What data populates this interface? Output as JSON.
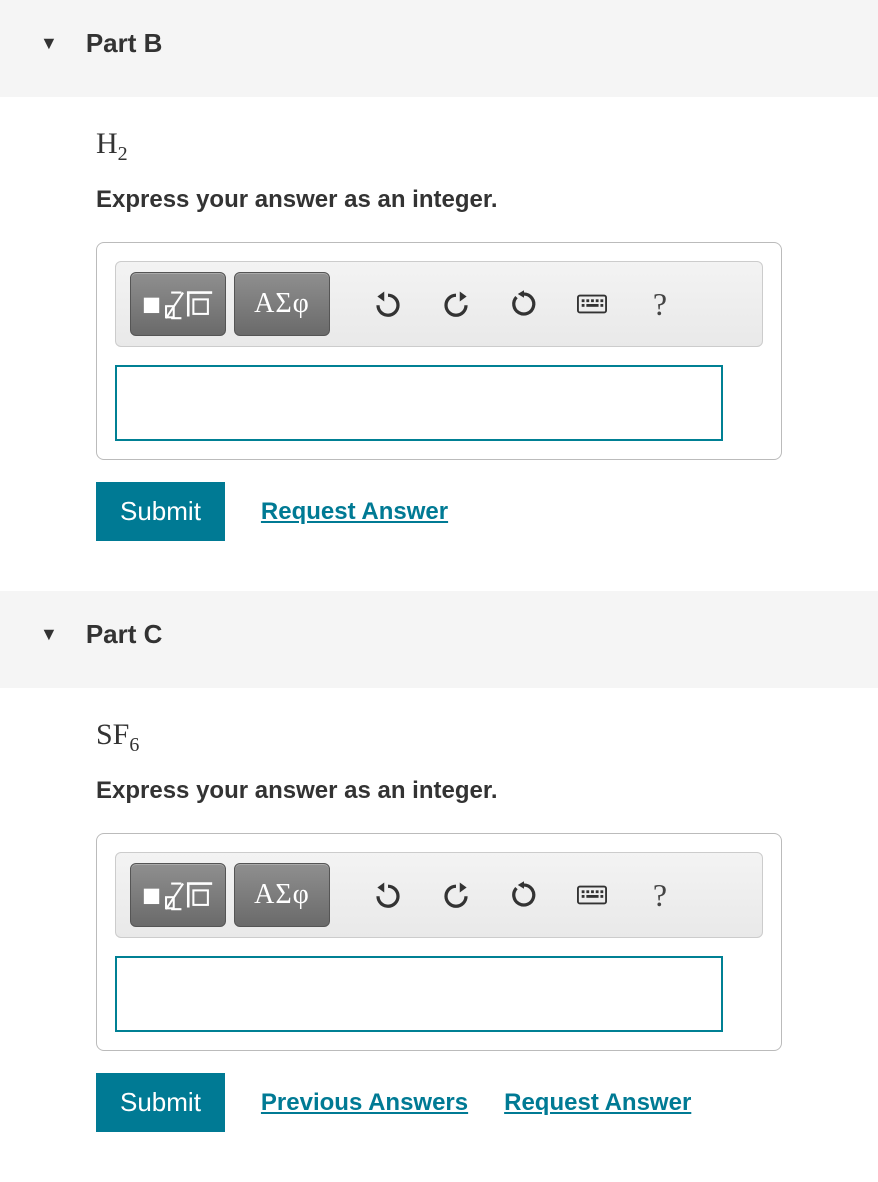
{
  "parts": [
    {
      "title": "Part B",
      "formula_main": "H",
      "formula_sub": "2",
      "instruction": "Express your answer as an integer.",
      "toolbar": {
        "greek": "ΑΣφ",
        "help": "?"
      },
      "input_value": "",
      "submit": "Submit",
      "links": [
        {
          "label": "Request Answer"
        }
      ]
    },
    {
      "title": "Part C",
      "formula_main": "SF",
      "formula_sub": "6",
      "instruction": "Express your answer as an integer.",
      "toolbar": {
        "greek": "ΑΣφ",
        "help": "?"
      },
      "input_value": "",
      "submit": "Submit",
      "links": [
        {
          "label": "Previous Answers"
        },
        {
          "label": "Request Answer"
        }
      ]
    }
  ]
}
